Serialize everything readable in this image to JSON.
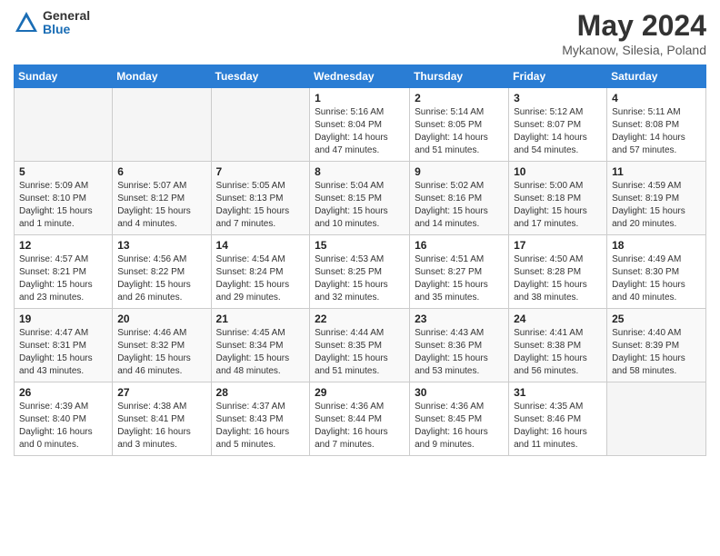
{
  "logo": {
    "general": "General",
    "blue": "Blue"
  },
  "title": "May 2024",
  "location": "Mykanow, Silesia, Poland",
  "days_of_week": [
    "Sunday",
    "Monday",
    "Tuesday",
    "Wednesday",
    "Thursday",
    "Friday",
    "Saturday"
  ],
  "weeks": [
    [
      {
        "day": "",
        "info": ""
      },
      {
        "day": "",
        "info": ""
      },
      {
        "day": "",
        "info": ""
      },
      {
        "day": "1",
        "info": "Sunrise: 5:16 AM\nSunset: 8:04 PM\nDaylight: 14 hours\nand 47 minutes."
      },
      {
        "day": "2",
        "info": "Sunrise: 5:14 AM\nSunset: 8:05 PM\nDaylight: 14 hours\nand 51 minutes."
      },
      {
        "day": "3",
        "info": "Sunrise: 5:12 AM\nSunset: 8:07 PM\nDaylight: 14 hours\nand 54 minutes."
      },
      {
        "day": "4",
        "info": "Sunrise: 5:11 AM\nSunset: 8:08 PM\nDaylight: 14 hours\nand 57 minutes."
      }
    ],
    [
      {
        "day": "5",
        "info": "Sunrise: 5:09 AM\nSunset: 8:10 PM\nDaylight: 15 hours\nand 1 minute."
      },
      {
        "day": "6",
        "info": "Sunrise: 5:07 AM\nSunset: 8:12 PM\nDaylight: 15 hours\nand 4 minutes."
      },
      {
        "day": "7",
        "info": "Sunrise: 5:05 AM\nSunset: 8:13 PM\nDaylight: 15 hours\nand 7 minutes."
      },
      {
        "day": "8",
        "info": "Sunrise: 5:04 AM\nSunset: 8:15 PM\nDaylight: 15 hours\nand 10 minutes."
      },
      {
        "day": "9",
        "info": "Sunrise: 5:02 AM\nSunset: 8:16 PM\nDaylight: 15 hours\nand 14 minutes."
      },
      {
        "day": "10",
        "info": "Sunrise: 5:00 AM\nSunset: 8:18 PM\nDaylight: 15 hours\nand 17 minutes."
      },
      {
        "day": "11",
        "info": "Sunrise: 4:59 AM\nSunset: 8:19 PM\nDaylight: 15 hours\nand 20 minutes."
      }
    ],
    [
      {
        "day": "12",
        "info": "Sunrise: 4:57 AM\nSunset: 8:21 PM\nDaylight: 15 hours\nand 23 minutes."
      },
      {
        "day": "13",
        "info": "Sunrise: 4:56 AM\nSunset: 8:22 PM\nDaylight: 15 hours\nand 26 minutes."
      },
      {
        "day": "14",
        "info": "Sunrise: 4:54 AM\nSunset: 8:24 PM\nDaylight: 15 hours\nand 29 minutes."
      },
      {
        "day": "15",
        "info": "Sunrise: 4:53 AM\nSunset: 8:25 PM\nDaylight: 15 hours\nand 32 minutes."
      },
      {
        "day": "16",
        "info": "Sunrise: 4:51 AM\nSunset: 8:27 PM\nDaylight: 15 hours\nand 35 minutes."
      },
      {
        "day": "17",
        "info": "Sunrise: 4:50 AM\nSunset: 8:28 PM\nDaylight: 15 hours\nand 38 minutes."
      },
      {
        "day": "18",
        "info": "Sunrise: 4:49 AM\nSunset: 8:30 PM\nDaylight: 15 hours\nand 40 minutes."
      }
    ],
    [
      {
        "day": "19",
        "info": "Sunrise: 4:47 AM\nSunset: 8:31 PM\nDaylight: 15 hours\nand 43 minutes."
      },
      {
        "day": "20",
        "info": "Sunrise: 4:46 AM\nSunset: 8:32 PM\nDaylight: 15 hours\nand 46 minutes."
      },
      {
        "day": "21",
        "info": "Sunrise: 4:45 AM\nSunset: 8:34 PM\nDaylight: 15 hours\nand 48 minutes."
      },
      {
        "day": "22",
        "info": "Sunrise: 4:44 AM\nSunset: 8:35 PM\nDaylight: 15 hours\nand 51 minutes."
      },
      {
        "day": "23",
        "info": "Sunrise: 4:43 AM\nSunset: 8:36 PM\nDaylight: 15 hours\nand 53 minutes."
      },
      {
        "day": "24",
        "info": "Sunrise: 4:41 AM\nSunset: 8:38 PM\nDaylight: 15 hours\nand 56 minutes."
      },
      {
        "day": "25",
        "info": "Sunrise: 4:40 AM\nSunset: 8:39 PM\nDaylight: 15 hours\nand 58 minutes."
      }
    ],
    [
      {
        "day": "26",
        "info": "Sunrise: 4:39 AM\nSunset: 8:40 PM\nDaylight: 16 hours\nand 0 minutes."
      },
      {
        "day": "27",
        "info": "Sunrise: 4:38 AM\nSunset: 8:41 PM\nDaylight: 16 hours\nand 3 minutes."
      },
      {
        "day": "28",
        "info": "Sunrise: 4:37 AM\nSunset: 8:43 PM\nDaylight: 16 hours\nand 5 minutes."
      },
      {
        "day": "29",
        "info": "Sunrise: 4:36 AM\nSunset: 8:44 PM\nDaylight: 16 hours\nand 7 minutes."
      },
      {
        "day": "30",
        "info": "Sunrise: 4:36 AM\nSunset: 8:45 PM\nDaylight: 16 hours\nand 9 minutes."
      },
      {
        "day": "31",
        "info": "Sunrise: 4:35 AM\nSunset: 8:46 PM\nDaylight: 16 hours\nand 11 minutes."
      },
      {
        "day": "",
        "info": ""
      }
    ]
  ]
}
